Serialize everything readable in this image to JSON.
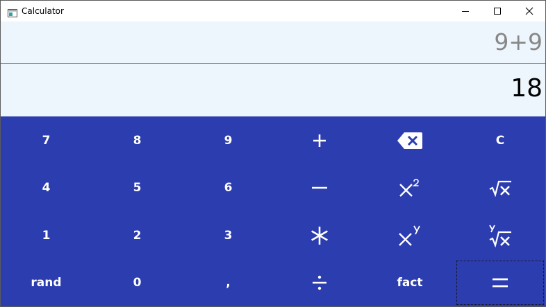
{
  "window": {
    "title": "Calculator",
    "app_icon": "calculator-window-icon",
    "controls": {
      "minimize_icon": "minimize-icon",
      "maximize_icon": "maximize-icon",
      "close_icon": "close-icon"
    }
  },
  "display": {
    "expression": "9+9",
    "result": "18"
  },
  "colors": {
    "keypad_background": "#2c3daf",
    "display_background": "#eef6fd",
    "expression_text": "#878787",
    "key_text": "#ffffff"
  },
  "keypad": {
    "seven": "7",
    "eight": "8",
    "nine": "9",
    "plus_icon": "plus-icon",
    "backspace_icon": "backspace-icon",
    "clear": "C",
    "four": "4",
    "five": "5",
    "six": "6",
    "minus_icon": "minus-icon",
    "square_icon": "x-squared-icon",
    "sqrt_icon": "square-root-icon",
    "one": "1",
    "two": "2",
    "three": "3",
    "multiply_icon": "asterisk-multiply-icon",
    "power_icon": "x-to-the-y-icon",
    "nth_root_icon": "y-th-root-icon",
    "rand": "rand",
    "zero": "0",
    "comma": ",",
    "divide_icon": "division-icon",
    "fact": "fact",
    "equals_icon": "equals-icon",
    "focused_key": "equals"
  }
}
